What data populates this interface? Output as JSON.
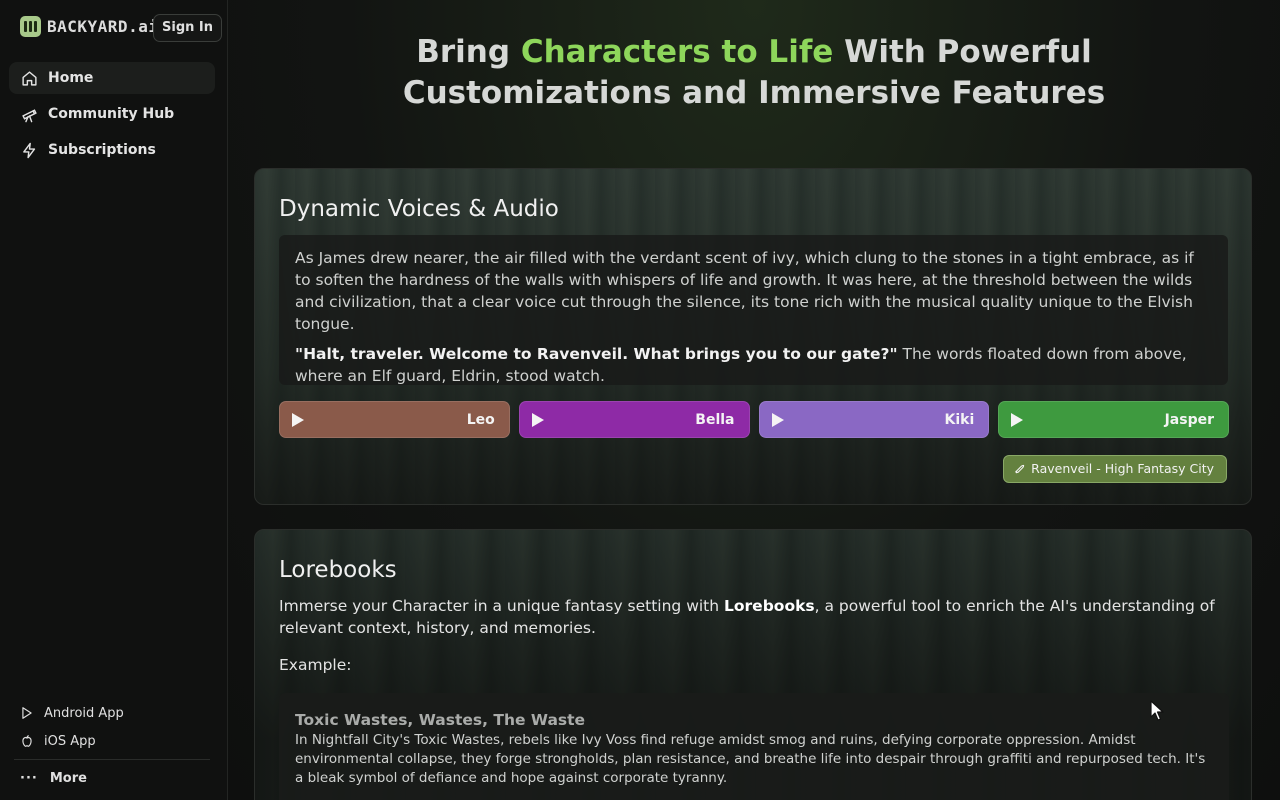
{
  "sidebar": {
    "brand": "BACKYARD.ai",
    "sign_in": "Sign In",
    "nav": [
      {
        "label": "Home",
        "icon": "home-icon",
        "active": true
      },
      {
        "label": "Community Hub",
        "icon": "telescope-icon",
        "active": false
      },
      {
        "label": "Subscriptions",
        "icon": "lightning-icon",
        "active": false
      }
    ],
    "bottom": {
      "android": "Android App",
      "ios": "iOS App",
      "more": "More"
    }
  },
  "hero": {
    "pre": "Bring ",
    "highlight": "Characters to Life",
    "post": " With Powerful",
    "line2": "Customizations and Immersive Features",
    "highlight_color": "#8ed65b"
  },
  "voices_card": {
    "title": "Dynamic Voices & Audio",
    "paragraph1": "As James drew nearer, the air filled with the verdant scent of ivy, which clung to the stones in a tight embrace, as if to soften the hardness of the walls with whispers of life and growth. It was here, at the threshold between the wilds and civilization, that a clear voice cut through the silence, its tone rich with the musical quality unique to the Elvish tongue.",
    "quote": "\"Halt, traveler. Welcome to Ravenveil. What brings you to our gate?\"",
    "paragraph2_rest": " The words floated down from above, where an Elf guard, Eldrin, stood watch.",
    "voices": [
      {
        "name": "Leo",
        "color": "#8a5a4a"
      },
      {
        "name": "Bella",
        "color": "#8e2aa6"
      },
      {
        "name": "Kiki",
        "color": "#8a68c4"
      },
      {
        "name": "Jasper",
        "color": "#3e9a3f"
      }
    ],
    "tag": "Ravenveil - High Fantasy City",
    "tag_icon": "rocket-icon"
  },
  "lore_card": {
    "title": "Lorebooks",
    "desc_pre": "Immerse your Character in a unique fantasy setting with ",
    "desc_bold": "Lorebooks",
    "desc_post": ", a powerful tool to enrich the AI's understanding of relevant context, history, and memories.",
    "example_label": "Example:",
    "entry_title": "Toxic Wastes, Wastes, The Waste",
    "entry_text": "In Nightfall City's Toxic Wastes, rebels like Ivy Voss find refuge amidst smog and ruins, defying corporate oppression. Amidst environmental collapse, they forge strongholds, plan resistance, and breathe life into despair through graffiti and repurposed tech. It's a bleak symbol of defiance and hope against corporate tyranny."
  }
}
